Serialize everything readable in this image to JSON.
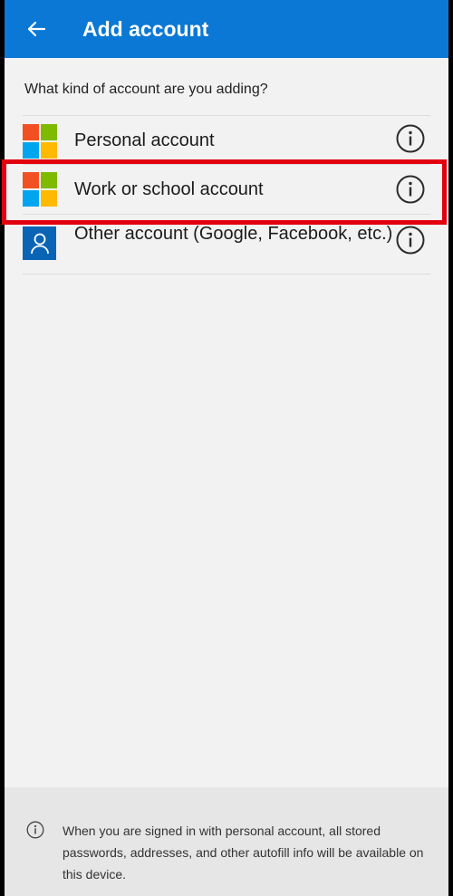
{
  "app_bar": {
    "title": "Add account",
    "back_icon": "arrow-left-icon",
    "color": "#0a78d4"
  },
  "prompt": "What kind of account are you adding?",
  "account_options": [
    {
      "label": "Personal account",
      "icon": "microsoft-logo-icon",
      "info_icon": "info-icon"
    },
    {
      "label": "Work or school account",
      "icon": "microsoft-logo-icon",
      "info_icon": "info-icon",
      "highlighted": true
    },
    {
      "label": "Other account (Google, Facebook, etc.)",
      "icon": "person-icon",
      "info_icon": "info-icon"
    }
  ],
  "highlight_color": "#e2000f",
  "footer": {
    "icon": "info-icon",
    "text": "When you are signed in with personal account, all stored passwords, addresses, and other autofill info will be available on this device."
  }
}
